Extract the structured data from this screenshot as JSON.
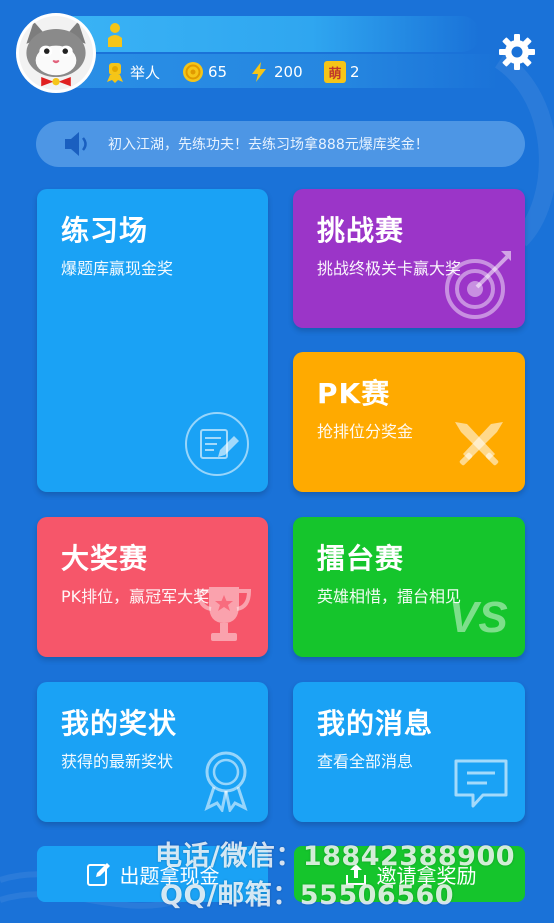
{
  "header": {
    "avatar_icon": "cat-avatar-icon",
    "stats": {
      "title_label": "举人",
      "coins": "65",
      "energy": "200",
      "badge_char": "萌",
      "badges": "2"
    },
    "settings_icon": "gear-icon"
  },
  "notice": {
    "icon": "speaker-icon",
    "text": "初入江湖，先练功夫！去练习场拿888元爆库奖金！"
  },
  "cards": {
    "practice": {
      "title": "练习场",
      "subtitle": "爆题库赢现金奖",
      "icon": "notebook-pen-icon",
      "color": "#1aa2f5"
    },
    "challenge": {
      "title": "挑战赛",
      "subtitle": "挑战终极关卡赢大奖",
      "icon": "target-icon",
      "color": "#9b35c8"
    },
    "pk": {
      "title": "PK赛",
      "subtitle": "抢排位分奖金",
      "icon": "crossed-swords-icon",
      "color": "#ffaa00"
    },
    "grand": {
      "title": "大奖赛",
      "subtitle": "PK排位，赢冠军大奖",
      "icon": "trophy-icon",
      "color": "#f6566a"
    },
    "arena": {
      "title": "擂台赛",
      "subtitle": "英雄相惜，擂台相见",
      "icon": "vs-icon",
      "icon_text": "VS",
      "color": "#15c52c"
    },
    "awards": {
      "title": "我的奖状",
      "subtitle": "获得的最新奖状",
      "icon": "medal-icon",
      "color": "#1aa2f5"
    },
    "messages": {
      "title": "我的消息",
      "subtitle": "查看全部消息",
      "icon": "message-icon",
      "color": "#1aa2f5"
    }
  },
  "bottom": {
    "submit_label": "出题拿现金",
    "invite_label": "邀请拿奖励"
  },
  "watermark": {
    "line1": "电话/微信：18842388900",
    "line2": "QQ/邮箱：55506560"
  }
}
